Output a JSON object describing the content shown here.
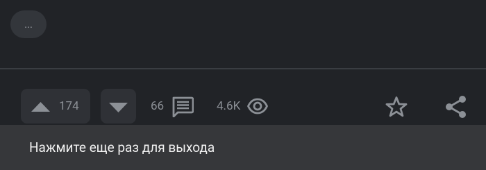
{
  "post": {
    "more_label": "...",
    "upvote_count": "174",
    "comment_count": "66",
    "view_count": "4.6K"
  },
  "icons": {
    "upvote": "triangle-up-icon",
    "downvote": "triangle-down-icon",
    "comments": "comment-icon",
    "views": "eye-icon",
    "favorite": "star-outline-icon",
    "share": "share-icon"
  },
  "toast": {
    "message": "Нажмите еще раз для выхода"
  },
  "colors": {
    "background": "#212327",
    "button_bg": "#2f3136",
    "icon": "#8c9096",
    "toast_bg": "#36373a",
    "toast_text": "#f1f1f1"
  }
}
